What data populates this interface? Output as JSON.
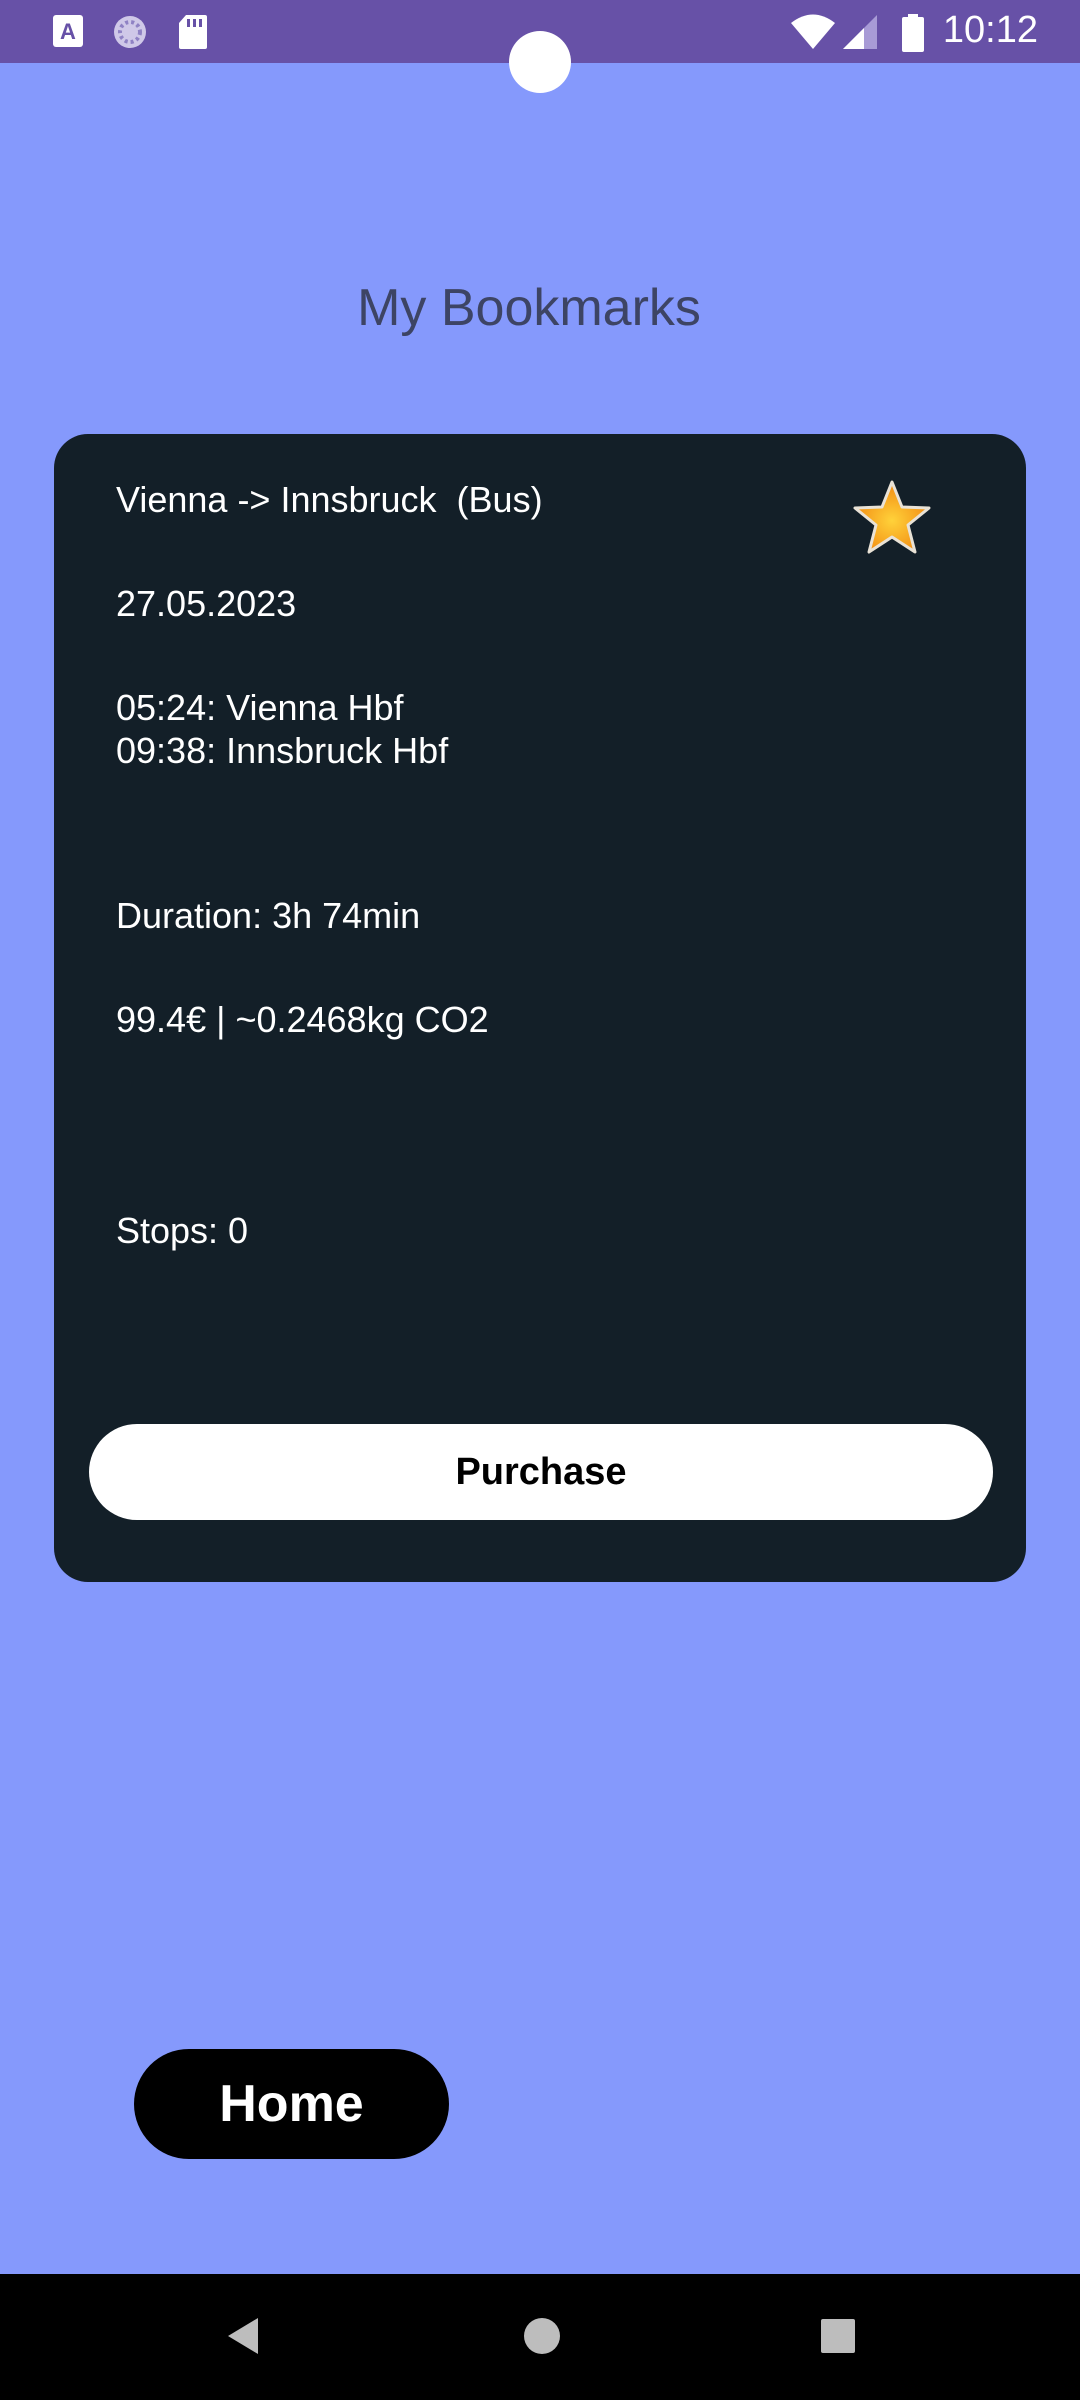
{
  "status_bar": {
    "time": "10:12",
    "icons": [
      "keyboard-a-icon",
      "sync-spinner-icon",
      "sd-card-icon",
      "wifi-icon",
      "cell-signal-icon",
      "battery-icon"
    ]
  },
  "page": {
    "title": "My Bookmarks"
  },
  "bookmark": {
    "route": "Vienna -> Innsbruck  (Bus)",
    "date": "27.05.2023",
    "departure": "05:24: Vienna Hbf",
    "arrival": "09:38: Innsbruck Hbf",
    "duration": "Duration: 3h 74min",
    "price_co2": "99.4€ | ~0.2468kg CO2",
    "stops": "Stops: 0",
    "bookmarked": true,
    "purchase_label": "Purchase"
  },
  "home": {
    "label": "Home"
  },
  "nav": {
    "icons": [
      "back-icon",
      "home-circle-icon",
      "recents-icon"
    ]
  },
  "colors": {
    "background": "#8599fc",
    "status_bar": "#6751a7",
    "card": "#131f28",
    "star": "#f7a21b"
  }
}
